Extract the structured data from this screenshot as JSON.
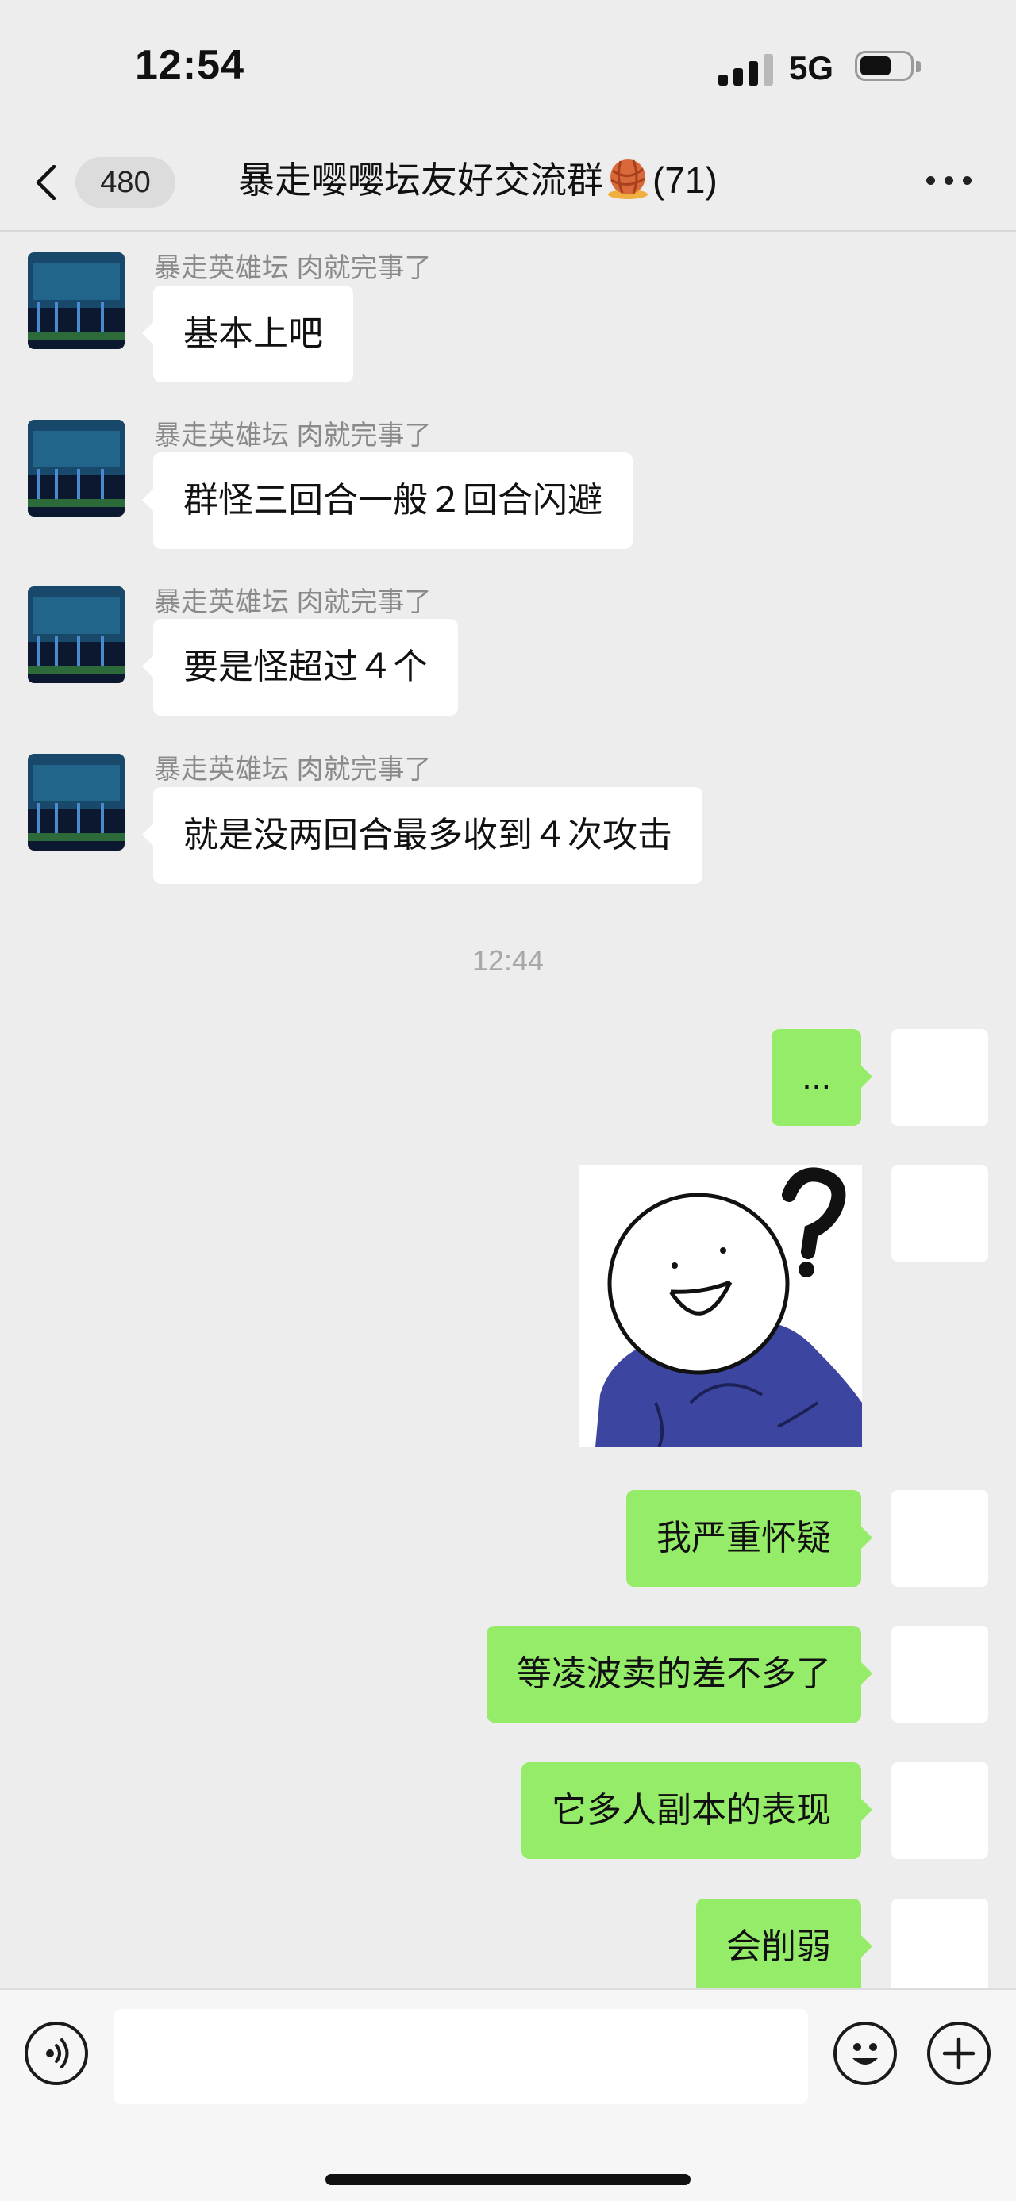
{
  "status_bar": {
    "time": "12:54",
    "network": "5G"
  },
  "header": {
    "unread_count": "480",
    "title": "暴走嘤嘤坛友好交流群",
    "member_count": "(71)",
    "title_icon": "yarn-ball-icon"
  },
  "messages": [
    {
      "sender": "暴走英雄坛 肉就完事了",
      "text": "基本上吧",
      "direction": "in"
    },
    {
      "sender": "暴走英雄坛 肉就完事了",
      "text": "群怪三回合一般２回合闪避",
      "direction": "in"
    },
    {
      "sender": "暴走英雄坛 肉就完事了",
      "text": "要是怪超过４个",
      "direction": "in"
    },
    {
      "sender": "暴走英雄坛 肉就完事了",
      "text": "就是没两回合最多收到４次攻击",
      "direction": "in"
    },
    {
      "timestamp": "12:44"
    },
    {
      "text": "...",
      "direction": "out"
    },
    {
      "sticker": "smiley-hoodie-question-sticker",
      "direction": "out"
    },
    {
      "text": "我严重怀疑",
      "direction": "out"
    },
    {
      "text": "等凌波卖的差不多了",
      "direction": "out"
    },
    {
      "text": "它多人副本的表现",
      "direction": "out"
    },
    {
      "text": "会削弱",
      "direction": "out"
    }
  ],
  "input": {
    "value": "",
    "placeholder": ""
  },
  "colors": {
    "background": "#ededed",
    "outgoing_bubble": "#95ec69",
    "incoming_bubble": "#ffffff"
  }
}
